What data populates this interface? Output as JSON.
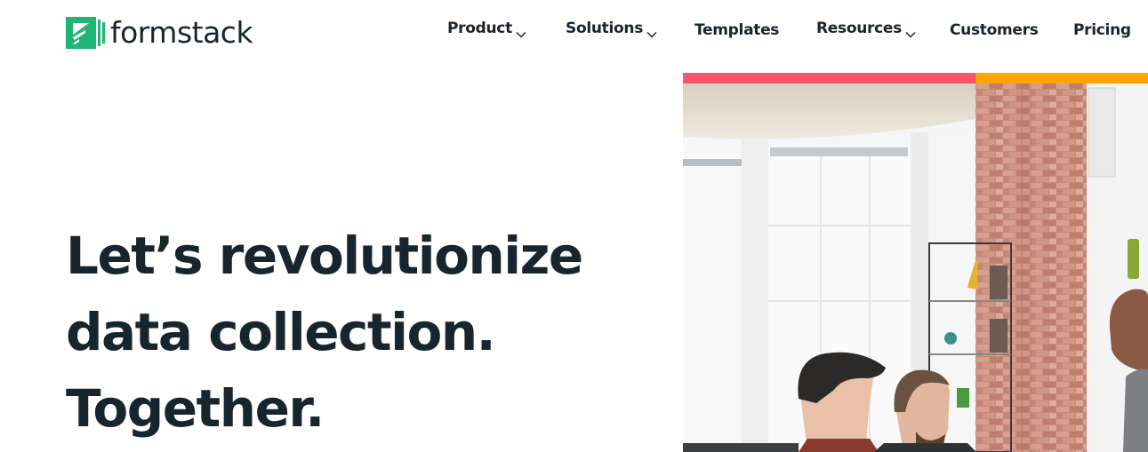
{
  "brand": {
    "name": "formstack",
    "logo_icon": "formstack-logo-icon",
    "primary_color": "#21b573"
  },
  "nav": {
    "items": [
      {
        "label": "Product",
        "has_dropdown": true,
        "icon": "chevron-down-icon"
      },
      {
        "label": "Solutions",
        "has_dropdown": true,
        "icon": "chevron-down-icon"
      },
      {
        "label": "Templates",
        "has_dropdown": false
      },
      {
        "label": "Resources",
        "has_dropdown": true,
        "icon": "chevron-down-icon"
      },
      {
        "label": "Customers",
        "has_dropdown": false
      },
      {
        "label": "Pricing",
        "has_dropdown": false
      }
    ]
  },
  "hero": {
    "headline_lines": [
      "Let’s revolutionize",
      "data collection.",
      "Together."
    ],
    "image_alt": "Team of coworkers looking at a screen in a bright office with brick wall and large windows",
    "accent_colors": {
      "left": "#ff5469",
      "right": "#ffa400"
    }
  },
  "colors": {
    "text": "#17262e",
    "background": "#ffffff"
  }
}
